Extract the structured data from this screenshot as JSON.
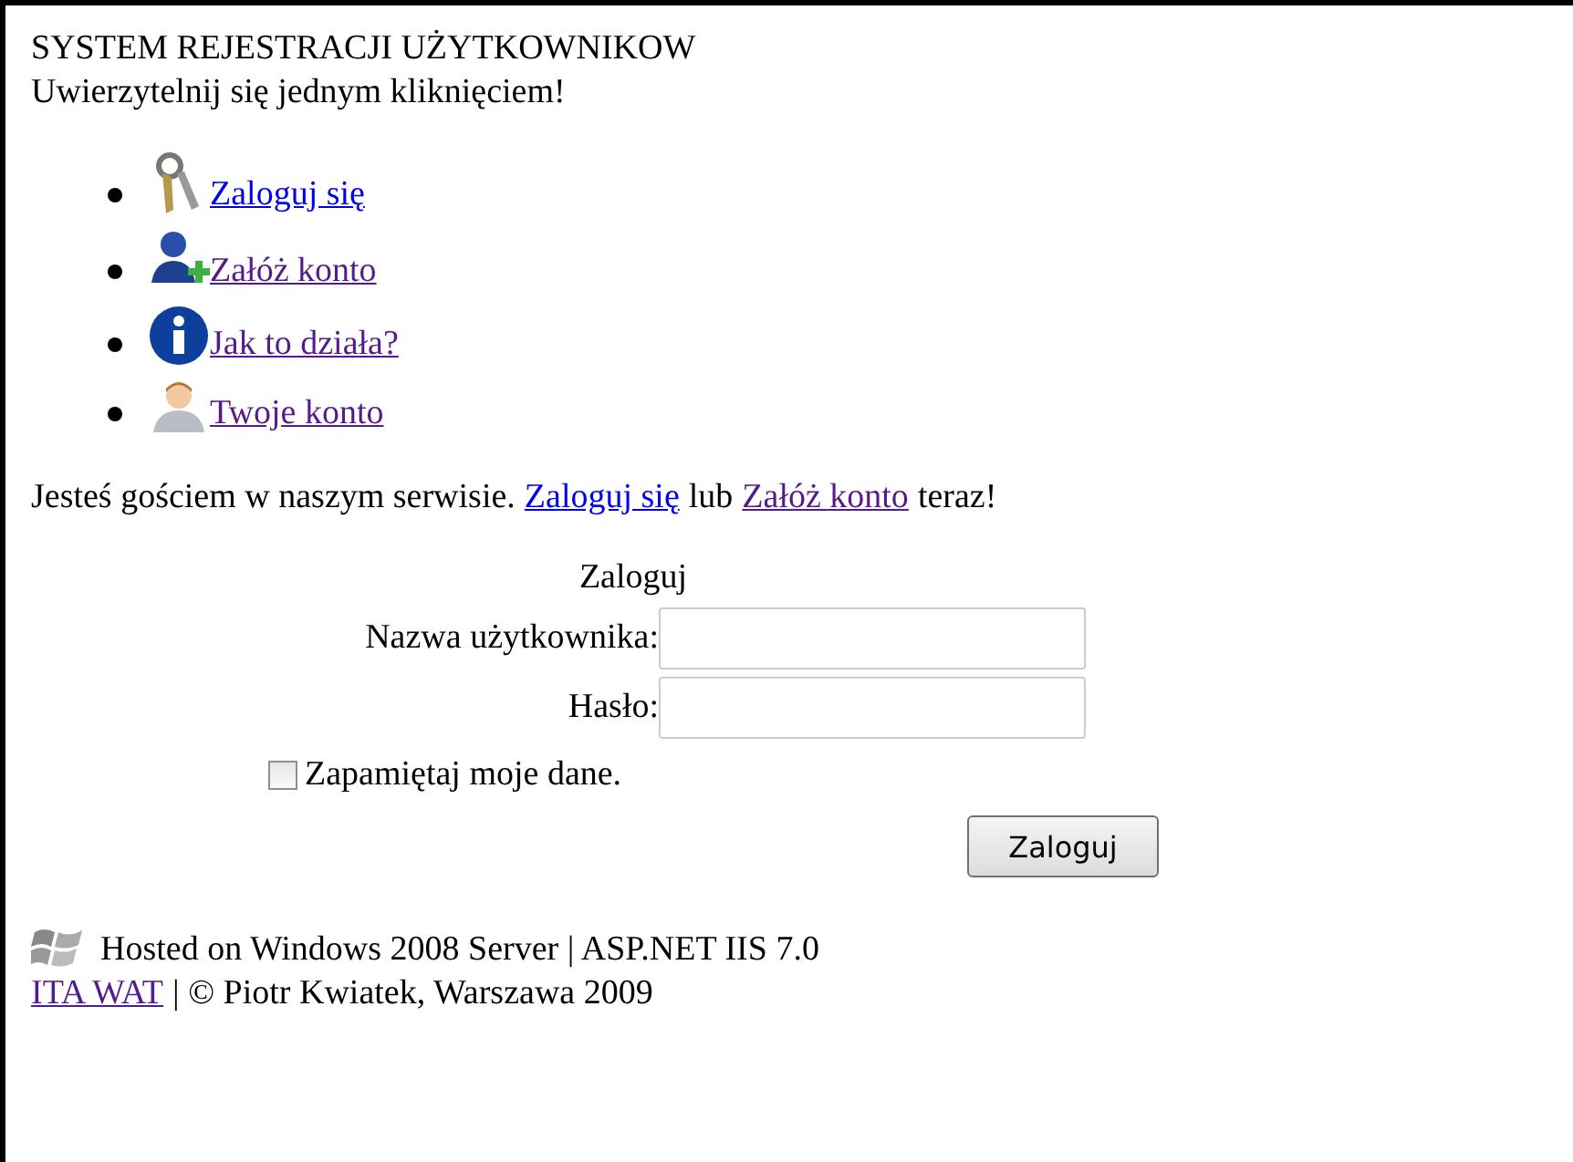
{
  "header": {
    "title": "SYSTEM REJESTRACJI UŻYTKOWNIKOW",
    "subtitle": "Uwierzytelnij się jednym kliknięciem!"
  },
  "menu": [
    {
      "kind": "keys",
      "label": "Zaloguj się",
      "visited": false
    },
    {
      "kind": "add-user",
      "label": "Załóż konto",
      "visited": true
    },
    {
      "kind": "info",
      "label": "Jak to działa?",
      "visited": true
    },
    {
      "kind": "user",
      "label": "Twoje konto",
      "visited": true
    }
  ],
  "guest_notice": {
    "before": "Jesteś gościem w naszym serwisie.",
    "link_1": {
      "label": "Zaloguj się",
      "visited": false
    },
    "middle": "lub",
    "link_2": {
      "label": "Załóż konto",
      "visited": true
    },
    "after": "teraz!"
  },
  "login_form": {
    "title": "Zaloguj",
    "username_label": "Nazwa użytkownika:",
    "password_label": "Hasło:",
    "remember": {
      "label": "Zapamiętaj moje dane.",
      "checked": false
    },
    "submit": "Zaloguj"
  },
  "footer": {
    "hosted": "Hosted on Windows 2008 Server | ASP.NET IIS 7.0",
    "link": {
      "label": "ITA WAT",
      "visited": true
    },
    "copyright": "| © Piotr Kwiatek, Warszawa 2009"
  }
}
